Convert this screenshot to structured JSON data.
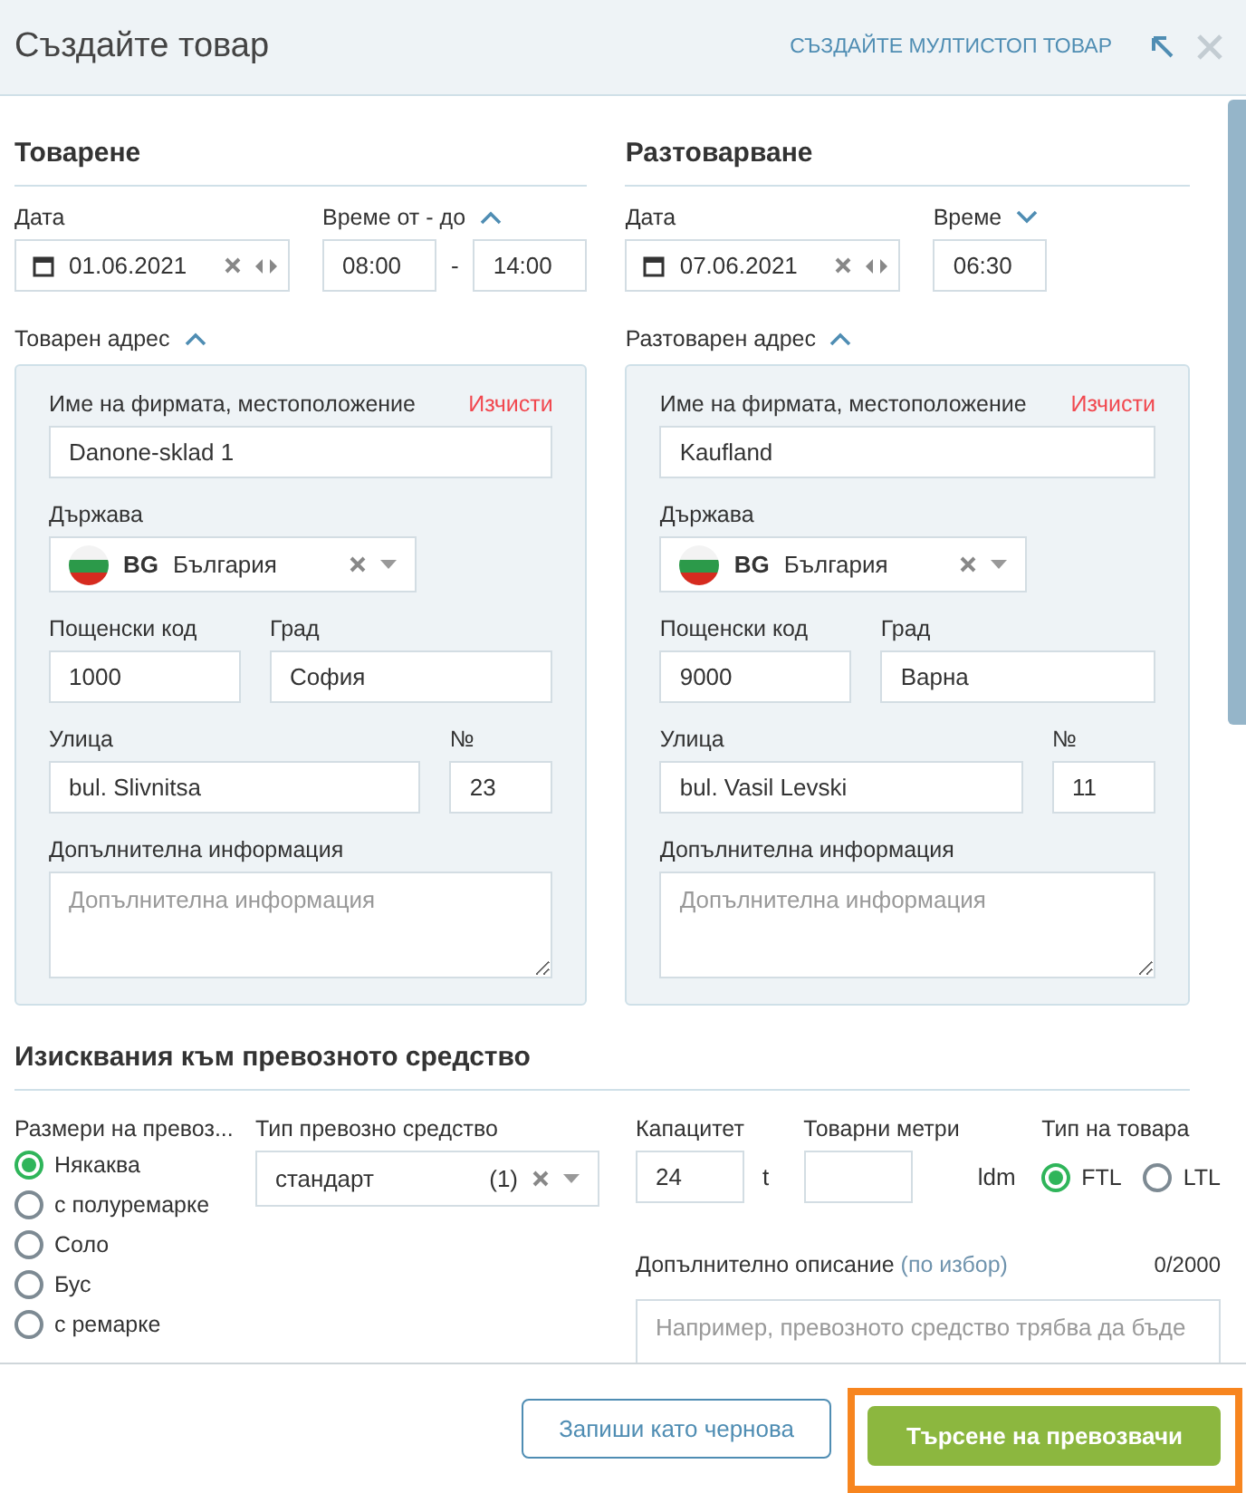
{
  "dialog": {
    "title": "Създайте товар",
    "multistop_link": "СЪЗДАЙТЕ МУЛТИСТОП ТОВАР"
  },
  "stops": [
    {
      "heading": "Товарене",
      "date_label": "Дата",
      "date": "01.06.2021",
      "time_label": "Време от - до",
      "time_expanded": true,
      "times": [
        "08:00",
        "14:00"
      ],
      "time_separator": "-",
      "address_label": "Товарен адрес",
      "address_expanded": true,
      "company_label": "Име на фирмата, местоположение",
      "clear": "Изчисти",
      "company": "Danone-sklad 1",
      "country_label": "Държава",
      "country_code": "BG",
      "country": "България",
      "postal_label": "Пощенски код",
      "postal": "1000",
      "city_label": "Град",
      "city": "София",
      "street_label": "Улица",
      "street": "bul. Slivnitsa",
      "number_label": "№",
      "number": "23",
      "info_label": "Допълнителна информация",
      "info_placeholder": "Допълнителна информация"
    },
    {
      "heading": "Разтоварване",
      "date_label": "Дата",
      "date": "07.06.2021",
      "time_label": "Време",
      "time_expanded": false,
      "times": [
        "06:30"
      ],
      "address_label": "Разтоварен адрес",
      "address_expanded": true,
      "company_label": "Име на фирмата, местоположение",
      "clear": "Изчисти",
      "company": "Kaufland",
      "country_label": "Държава",
      "country_code": "BG",
      "country": "България",
      "postal_label": "Пощенски код",
      "postal": "9000",
      "city_label": "Град",
      "city": "Варна",
      "street_label": "Улица",
      "street": "bul. Vasil Levski",
      "number_label": "№",
      "number": "11",
      "info_label": "Допълнителна информация",
      "info_placeholder": "Допълнителна информация"
    }
  ],
  "vehicle": {
    "heading": "Изисквания към превозното средство",
    "size_label": "Размери на превоз...",
    "sizes": [
      {
        "label": "Някаква",
        "selected": true
      },
      {
        "label": "с полуремарке",
        "selected": false
      },
      {
        "label": "Соло",
        "selected": false
      },
      {
        "label": "Бус",
        "selected": false
      },
      {
        "label": "с ремарке",
        "selected": false
      }
    ],
    "type_label": "Тип превозно средство",
    "type_value": "стандарт",
    "type_count": "(1)",
    "capacity_label": "Капацитет",
    "capacity": "24",
    "capacity_unit": "t",
    "meters_label": "Товарни метри",
    "meters_unit": "ldm",
    "cargo_label": "Тип на товара",
    "cargo_options": [
      {
        "label": "FTL",
        "selected": true
      },
      {
        "label": "LTL",
        "selected": false
      }
    ],
    "description_label": "Допълнително описание",
    "description_optional": "(по избор)",
    "description_counter": "0/2000",
    "description_placeholder": "Например, превозното средство трябва да бъде"
  },
  "footer": {
    "buttons": [
      {
        "label": "Запиши като чернова",
        "kind": "secondary",
        "highlighted": false
      },
      {
        "label": "Търсене на превозвачи",
        "kind": "primary",
        "highlighted": true
      }
    ]
  }
}
